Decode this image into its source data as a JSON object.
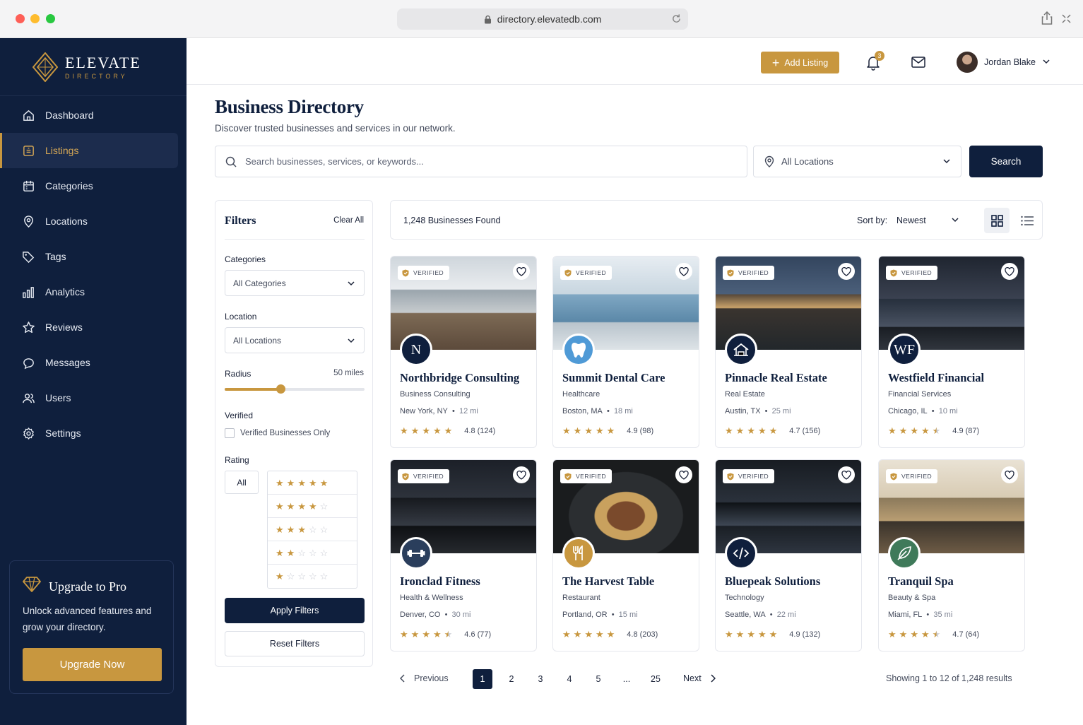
{
  "browser": {
    "url": "directory.elevatedb.com"
  },
  "brand": {
    "name": "ELEVATE",
    "sub": "DIRECTORY",
    "accent": "#c8973f",
    "navy": "#0f1f3d"
  },
  "sidebar": {
    "items": [
      {
        "label": "Dashboard",
        "icon": "home-icon"
      },
      {
        "label": "Listings",
        "icon": "listing-icon",
        "active": true
      },
      {
        "label": "Categories",
        "icon": "calendar-icon"
      },
      {
        "label": "Locations",
        "icon": "pin-icon"
      },
      {
        "label": "Tags",
        "icon": "tag-icon"
      },
      {
        "label": "Analytics",
        "icon": "bar-chart-icon"
      },
      {
        "label": "Reviews",
        "icon": "star-icon"
      },
      {
        "label": "Messages",
        "icon": "chat-icon"
      },
      {
        "label": "Users",
        "icon": "users-icon"
      },
      {
        "label": "Settings",
        "icon": "gear-icon"
      }
    ],
    "upgrade": {
      "title": "Upgrade to Pro",
      "text": "Unlock advanced features and grow your directory.",
      "button": "Upgrade Now"
    }
  },
  "topbar": {
    "add_label": "Add Listing",
    "notifications": "3",
    "user_name": "Jordan Blake"
  },
  "header": {
    "title": "Business Directory",
    "subtitle": "Discover trusted businesses and services in our network."
  },
  "search": {
    "placeholder": "Search businesses, services, or keywords...",
    "location": "All Locations",
    "button": "Search"
  },
  "filters": {
    "title": "Filters",
    "clear": "Clear All",
    "categories_label": "Categories",
    "categories_value": "All Categories",
    "location_label": "Location",
    "location_value": "All Locations",
    "radius_label": "Radius",
    "radius_value": "50 miles",
    "radius_fraction": 0.4,
    "verified_label": "Verified",
    "verified_option": "Verified Businesses Only",
    "rating_label": "Rating",
    "rating_all": "All",
    "rating_options": [
      5,
      4,
      3,
      2,
      1
    ],
    "apply": "Apply Filters",
    "reset": "Reset Filters"
  },
  "results": {
    "count": "1,248 Businesses Found",
    "sort_label": "Sort by:",
    "sort_value": "Newest"
  },
  "verified_badge": "VERIFIED",
  "listings": [
    {
      "name": "Northbridge Consulting",
      "category": "Business Consulting",
      "city": "New York, NY",
      "distance": "12 mi",
      "rating": "4.8 (124)",
      "stars": 5,
      "logo": "N",
      "logo_icon": "letter-n-icon",
      "logo_bg": "#0f1f3d"
    },
    {
      "name": "Summit Dental Care",
      "category": "Healthcare",
      "city": "Boston, MA",
      "distance": "18 mi",
      "rating": "4.9 (98)",
      "stars": 5,
      "logo": "",
      "logo_icon": "tooth-icon",
      "logo_bg": "#4f9ad6"
    },
    {
      "name": "Pinnacle Real Estate",
      "category": "Real Estate",
      "city": "Austin, TX",
      "distance": "25 mi",
      "rating": "4.7 (156)",
      "stars": 5,
      "logo": "",
      "logo_icon": "house-icon",
      "logo_bg": "#0f1f3d"
    },
    {
      "name": "Westfield Financial",
      "category": "Financial Services",
      "city": "Chicago, IL",
      "distance": "10 mi",
      "rating": "4.9 (87)",
      "stars": 4.5,
      "logo": "WF",
      "logo_icon": "letters-wf-icon",
      "logo_bg": "#0f1f3d"
    },
    {
      "name": "Ironclad Fitness",
      "category": "Health & Wellness",
      "city": "Denver, CO",
      "distance": "30 mi",
      "rating": "4.6 (77)",
      "stars": 4.5,
      "logo": "",
      "logo_icon": "dumbbell-icon",
      "logo_bg": "#2a3e5c"
    },
    {
      "name": "The Harvest Table",
      "category": "Restaurant",
      "city": "Portland, OR",
      "distance": "15 mi",
      "rating": "4.8 (203)",
      "stars": 5,
      "logo": "",
      "logo_icon": "utensils-icon",
      "logo_bg": "#c8973f"
    },
    {
      "name": "Bluepeak Solutions",
      "category": "Technology",
      "city": "Seattle, WA",
      "distance": "22 mi",
      "rating": "4.9 (132)",
      "stars": 5,
      "logo": "",
      "logo_icon": "code-icon",
      "logo_bg": "#0f1f3d"
    },
    {
      "name": "Tranquil Spa",
      "category": "Beauty & Spa",
      "city": "Miami, FL",
      "distance": "35 mi",
      "rating": "4.7 (64)",
      "stars": 4.5,
      "logo": "",
      "logo_icon": "leaf-icon",
      "logo_bg": "#3f7a5a"
    }
  ],
  "pagination": {
    "previous": "Previous",
    "pages": [
      "1",
      "2",
      "3",
      "4",
      "5",
      "...",
      "25"
    ],
    "current": "1",
    "next": "Next",
    "showing": "Showing 1 to 12 of 1,248 results"
  }
}
